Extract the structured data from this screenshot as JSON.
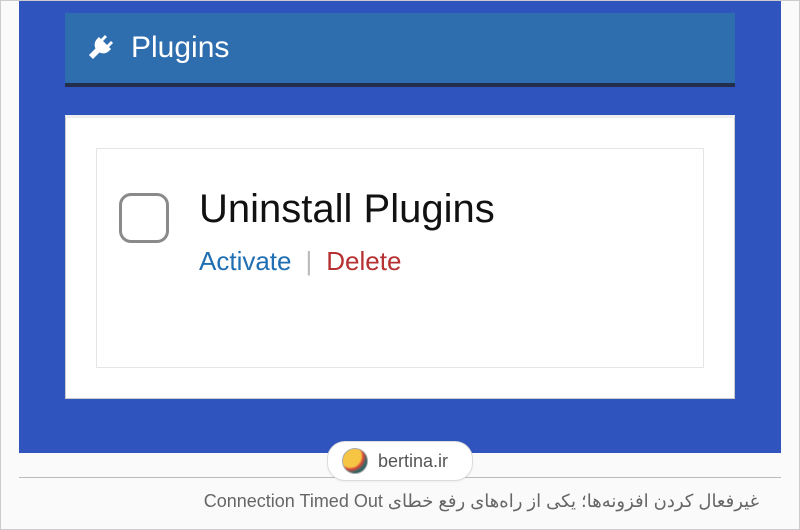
{
  "header": {
    "title": "Plugins",
    "icon": "plug-icon"
  },
  "plugin": {
    "title": "Uninstall Plugins",
    "actions": {
      "activate": "Activate",
      "separator": "|",
      "delete": "Delete"
    }
  },
  "badge": {
    "text": "bertina.ir"
  },
  "caption": "غیرفعال کردن افزونه‌ها؛ یکی از راه‌های رفع خطای Connection Timed Out"
}
